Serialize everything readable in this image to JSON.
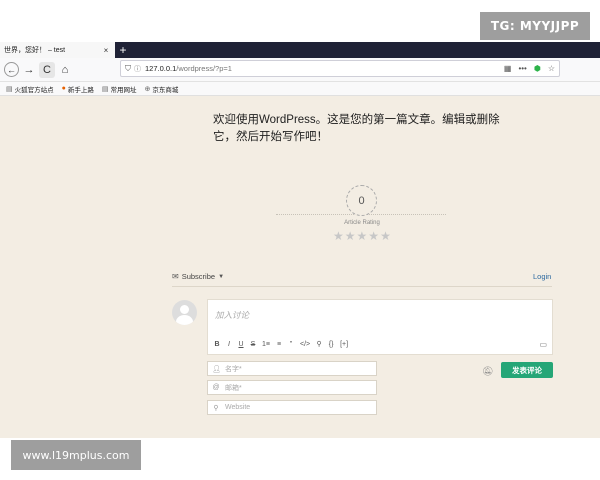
{
  "watermarks": {
    "top": "TG: MYYJJPP",
    "bottom": "www.l19mplus.com"
  },
  "browser": {
    "tab": {
      "title": "世界，您好！ – test",
      "close": "×"
    },
    "new_tab": "+",
    "nav": {
      "back": "←",
      "forward": "→",
      "reload": "C",
      "home": "⌂"
    },
    "url": {
      "host": "127.0.0.1",
      "path": "/wordpress/?p=1",
      "menu": "•••",
      "star": "☆"
    },
    "bookmarks": [
      {
        "label": "火狐官方站点",
        "icon": "folder-icon"
      },
      {
        "label": "新手上路",
        "icon": "firefox-icon"
      },
      {
        "label": "常用网址",
        "icon": "folder-icon"
      },
      {
        "label": "京东商城",
        "icon": "globe-icon"
      }
    ]
  },
  "post": {
    "headline": "欢迎使用WordPress。这是您的第一篇文章。编辑或删除它，然后开始写作吧！"
  },
  "rating": {
    "value": "0",
    "label": "Article Rating",
    "stars_max": 5,
    "stars_filled": 0
  },
  "comments": {
    "subscribe_label": "Subscribe",
    "login_label": "Login",
    "placeholder": "加入讨论",
    "toolbar": [
      "B",
      "I",
      "U",
      "S",
      "1≡",
      "≡",
      "”",
      "</>",
      "⚲",
      "{}",
      "[+]"
    ],
    "name_placeholder": "名字*",
    "email_placeholder": "邮箱*",
    "website_placeholder": "Website",
    "submit_label": "发表评论"
  },
  "colors": {
    "page_bg": "#f3ede3",
    "submit": "#25a677",
    "tabbar": "#1f2236",
    "login_link": "#2e6aa0"
  }
}
